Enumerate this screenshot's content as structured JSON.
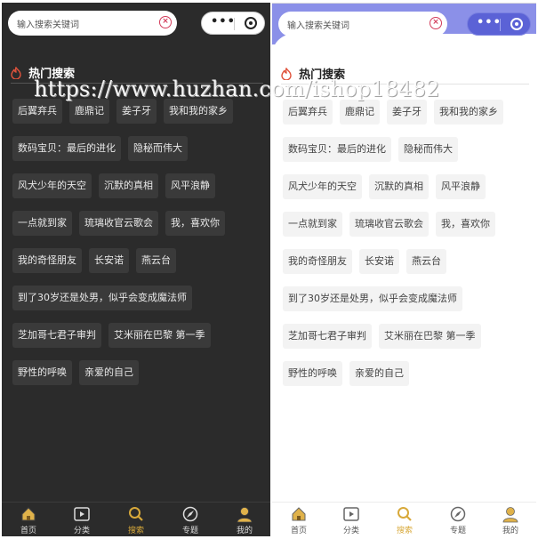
{
  "search": {
    "placeholder": "输入搜索关键词"
  },
  "capsule": {
    "menu_dots": "•••"
  },
  "hot_section": {
    "title": "热门搜索"
  },
  "hot_tags": [
    "后翼弃兵",
    "鹿鼎记",
    "姜子牙",
    "我和我的家乡",
    "数码宝贝：最后的进化",
    "隐秘而伟大",
    "风犬少年的天空",
    "沉默的真相",
    "风平浪静",
    "一点就到家",
    "琉璃收官云歌会",
    "我，喜欢你",
    "我的奇怪朋友",
    "长安诺",
    "燕云台",
    "到了30岁还是处男，似乎会变成魔法师",
    "芝加哥七君子审判",
    "艾米丽在巴黎 第一季",
    "野性的呼唤",
    "亲爱的自己"
  ],
  "tabs": [
    {
      "label": "首页",
      "icon": "home-icon"
    },
    {
      "label": "分类",
      "icon": "play-icon"
    },
    {
      "label": "搜索",
      "icon": "search-icon",
      "active": true
    },
    {
      "label": "专题",
      "icon": "compass-icon"
    },
    {
      "label": "我的",
      "icon": "user-icon"
    }
  ],
  "watermark": "https://www.huzhan.com/ishop18482",
  "colors": {
    "dark_bg": "#2b2b2b",
    "accent": "#d8a93a",
    "light_header": "#8b90e8",
    "clear_icon": "#d23b5a"
  }
}
